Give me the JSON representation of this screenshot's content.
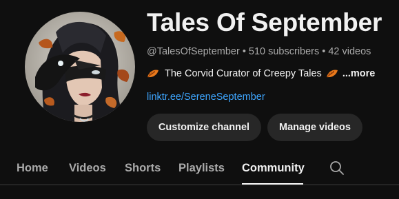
{
  "channel": {
    "name": "Tales Of September",
    "handle": "@TalesOfSeptember",
    "subscribers": "510 subscribers",
    "videos": "42 videos",
    "meta_separator": "•",
    "description": "The Corvid Curator of Creepy Tales",
    "more_label": "...more",
    "link": "linktr.ee/SereneSeptember"
  },
  "buttons": {
    "customize": "Customize channel",
    "manage": "Manage videos"
  },
  "tabs": [
    {
      "label": "Home",
      "active": false
    },
    {
      "label": "Videos",
      "active": false
    },
    {
      "label": "Shorts",
      "active": false
    },
    {
      "label": "Playlists",
      "active": false
    },
    {
      "label": "Community",
      "active": true
    }
  ],
  "icons": {
    "search": "search-icon",
    "leaf": "autumn-leaf-icon"
  },
  "colors": {
    "background": "#0f0f0f",
    "text": "#f1f1f1",
    "secondary_text": "#aaaaaa",
    "link": "#3ea6ff",
    "button_bg": "#272727",
    "leaf": "#e8791b"
  }
}
